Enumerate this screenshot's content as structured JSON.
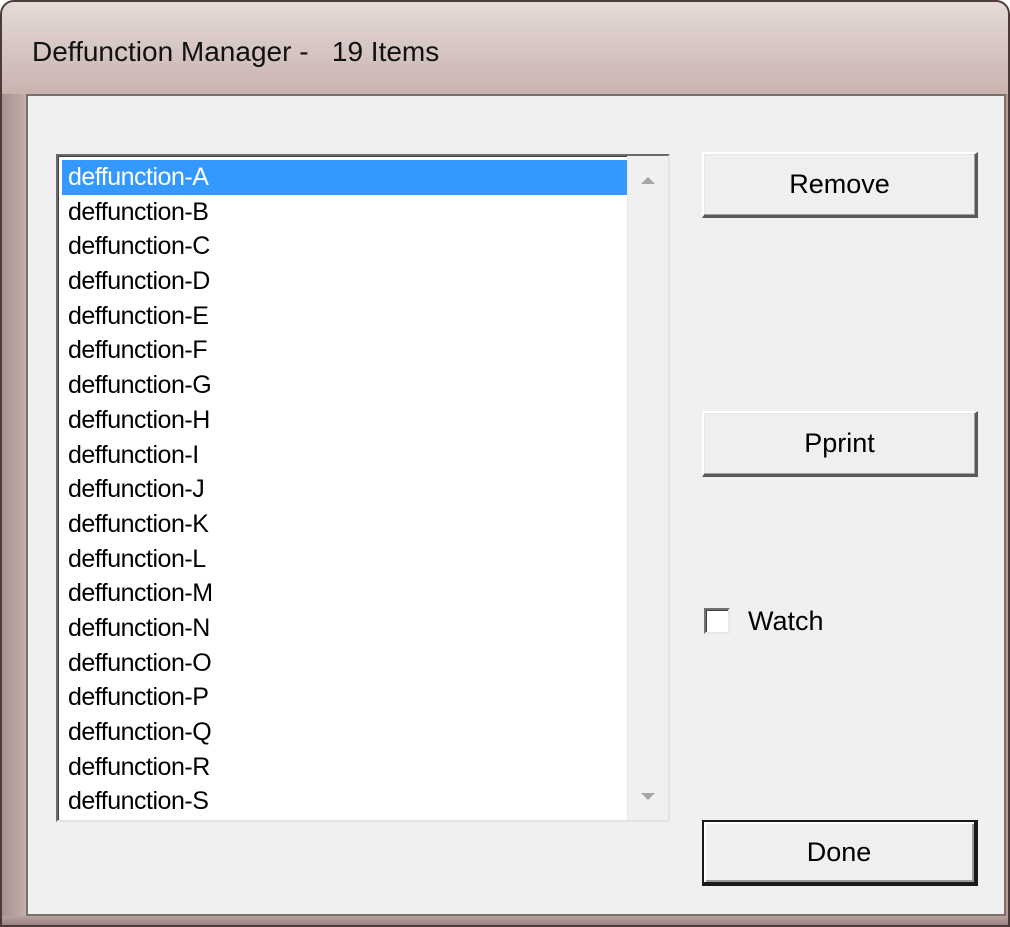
{
  "window": {
    "title": "Deffunction Manager -   19 Items"
  },
  "list": {
    "items": [
      "deffunction-A",
      "deffunction-B",
      "deffunction-C",
      "deffunction-D",
      "deffunction-E",
      "deffunction-F",
      "deffunction-G",
      "deffunction-H",
      "deffunction-I",
      "deffunction-J",
      "deffunction-K",
      "deffunction-L",
      "deffunction-M",
      "deffunction-N",
      "deffunction-O",
      "deffunction-P",
      "deffunction-Q",
      "deffunction-R",
      "deffunction-S"
    ],
    "selected": "deffunction-A",
    "selection_color": "#3399ff"
  },
  "buttons": {
    "remove_label": "Remove",
    "pprint_label": "Pprint",
    "done_label": "Done"
  },
  "watch": {
    "label": "Watch",
    "checked": false
  },
  "icons": {
    "scroll_up": "chevron-up-icon",
    "scroll_down": "chevron-down-icon"
  }
}
